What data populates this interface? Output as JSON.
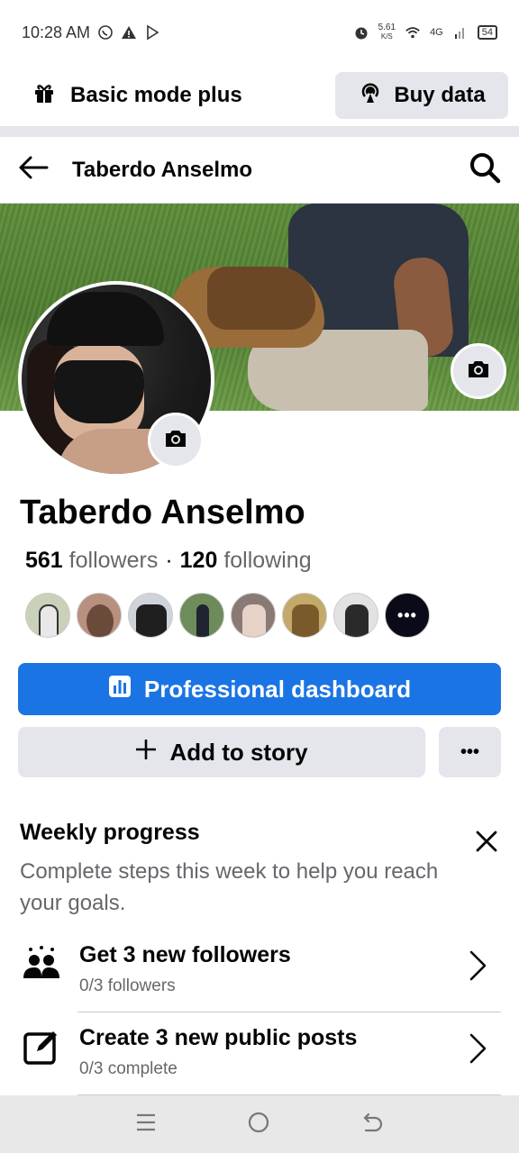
{
  "status_bar": {
    "time": "10:28 AM",
    "net_speed_value": "5.61",
    "net_speed_unit": "K/S",
    "network": "4G",
    "battery": "54",
    "icons": [
      "whatsapp-icon",
      "warning-icon",
      "play-store-icon",
      "alarm-icon",
      "wifi-icon",
      "signal-icon",
      "battery-icon"
    ]
  },
  "top_bar": {
    "basic_mode_label": "Basic mode plus",
    "buy_data_label": "Buy data"
  },
  "header": {
    "title": "Taberdo Anselmo"
  },
  "profile": {
    "name": "Taberdo Anselmo",
    "followers_count": "561",
    "followers_label": "followers",
    "separator": "·",
    "following_count": "120",
    "following_label": "following",
    "friend_avatars": 7,
    "more_label": "•••"
  },
  "actions": {
    "professional_dashboard": "Professional dashboard",
    "add_to_story": "Add to story",
    "more": "•••"
  },
  "weekly_progress": {
    "title": "Weekly progress",
    "description": "Complete steps this week to help you reach your goals.",
    "tasks": [
      {
        "title": "Get 3 new followers",
        "subtitle": "0/3 followers"
      },
      {
        "title": "Create 3 new public posts",
        "subtitle": "0/3 complete"
      }
    ]
  },
  "colors": {
    "primary": "#1b74e4",
    "secondary_button": "#e4e6eb",
    "muted_text": "#65676b"
  }
}
